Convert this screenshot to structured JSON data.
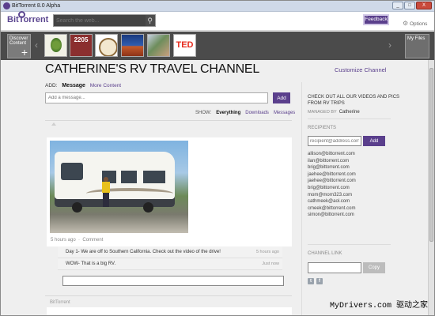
{
  "window": {
    "title": "BitTorrent 8.0 Alpha",
    "buttons": [
      "_",
      "□",
      "X"
    ]
  },
  "header": {
    "brand": "BitTorrent",
    "search_placeholder": "Search the web...",
    "feedback_label": "Feedback",
    "options_label": "Options"
  },
  "apps": {
    "discover_label": "Discover Content",
    "tiles": [
      {
        "name": "tree-app",
        "label": ""
      },
      {
        "name": "2205-app",
        "label": "2205"
      },
      {
        "name": "seal-app",
        "label": ""
      },
      {
        "name": "sunset-app",
        "label": ""
      },
      {
        "name": "photo-app",
        "label": ""
      },
      {
        "name": "ted-app",
        "label": "TED"
      }
    ],
    "myfiles_label": "My Files"
  },
  "channel": {
    "title": "CATHERINE'S RV TRAVEL CHANNEL",
    "customize_label": "Customize Channel",
    "add_label": "ADD:",
    "add_message_tab": "Message",
    "add_more_tab": "More Content",
    "message_placeholder": "Add a message...",
    "add_button": "Add",
    "show_label": "SHOW:",
    "filters": [
      "Everything",
      "Downloads",
      "Messages"
    ]
  },
  "post": {
    "meta_time": "5 hours ago",
    "meta_comment": "Comment",
    "comments": [
      {
        "text": "Day 1- We are off to Southern California. Check out the video of the drive!",
        "when": "5 hours ago"
      },
      {
        "text": "WOW- That is a big RV.",
        "when": "Just now"
      }
    ],
    "next_author": "BitTorrent"
  },
  "sidebar": {
    "description": "CHECK OUT ALL OUR VIDEOS AND PICS FROM RV TRIPS",
    "managed_by_label": "MANAGED BY",
    "managed_by": "Catherine",
    "recipients_heading": "RECIPIENTS",
    "recipient_placeholder": "recipient@address.com",
    "recipient_add": "Add",
    "recipients": [
      "allison@bittorrent.com",
      "ilan@bittorrent.com",
      "brig@bittorrent.com",
      "jaehee@bittorrent.com",
      "jaehee@bittorrent.com",
      "brig@bittorrent.com",
      "mom@morn323.com",
      "cathmeek@aol.com",
      "cmeek@bittorrent.com",
      "simon@bittorrent.com"
    ],
    "channel_link_heading": "CHANNEL LINK",
    "copy_label": "Copy"
  },
  "watermark": "MyDrivers.com 驱动之家"
}
